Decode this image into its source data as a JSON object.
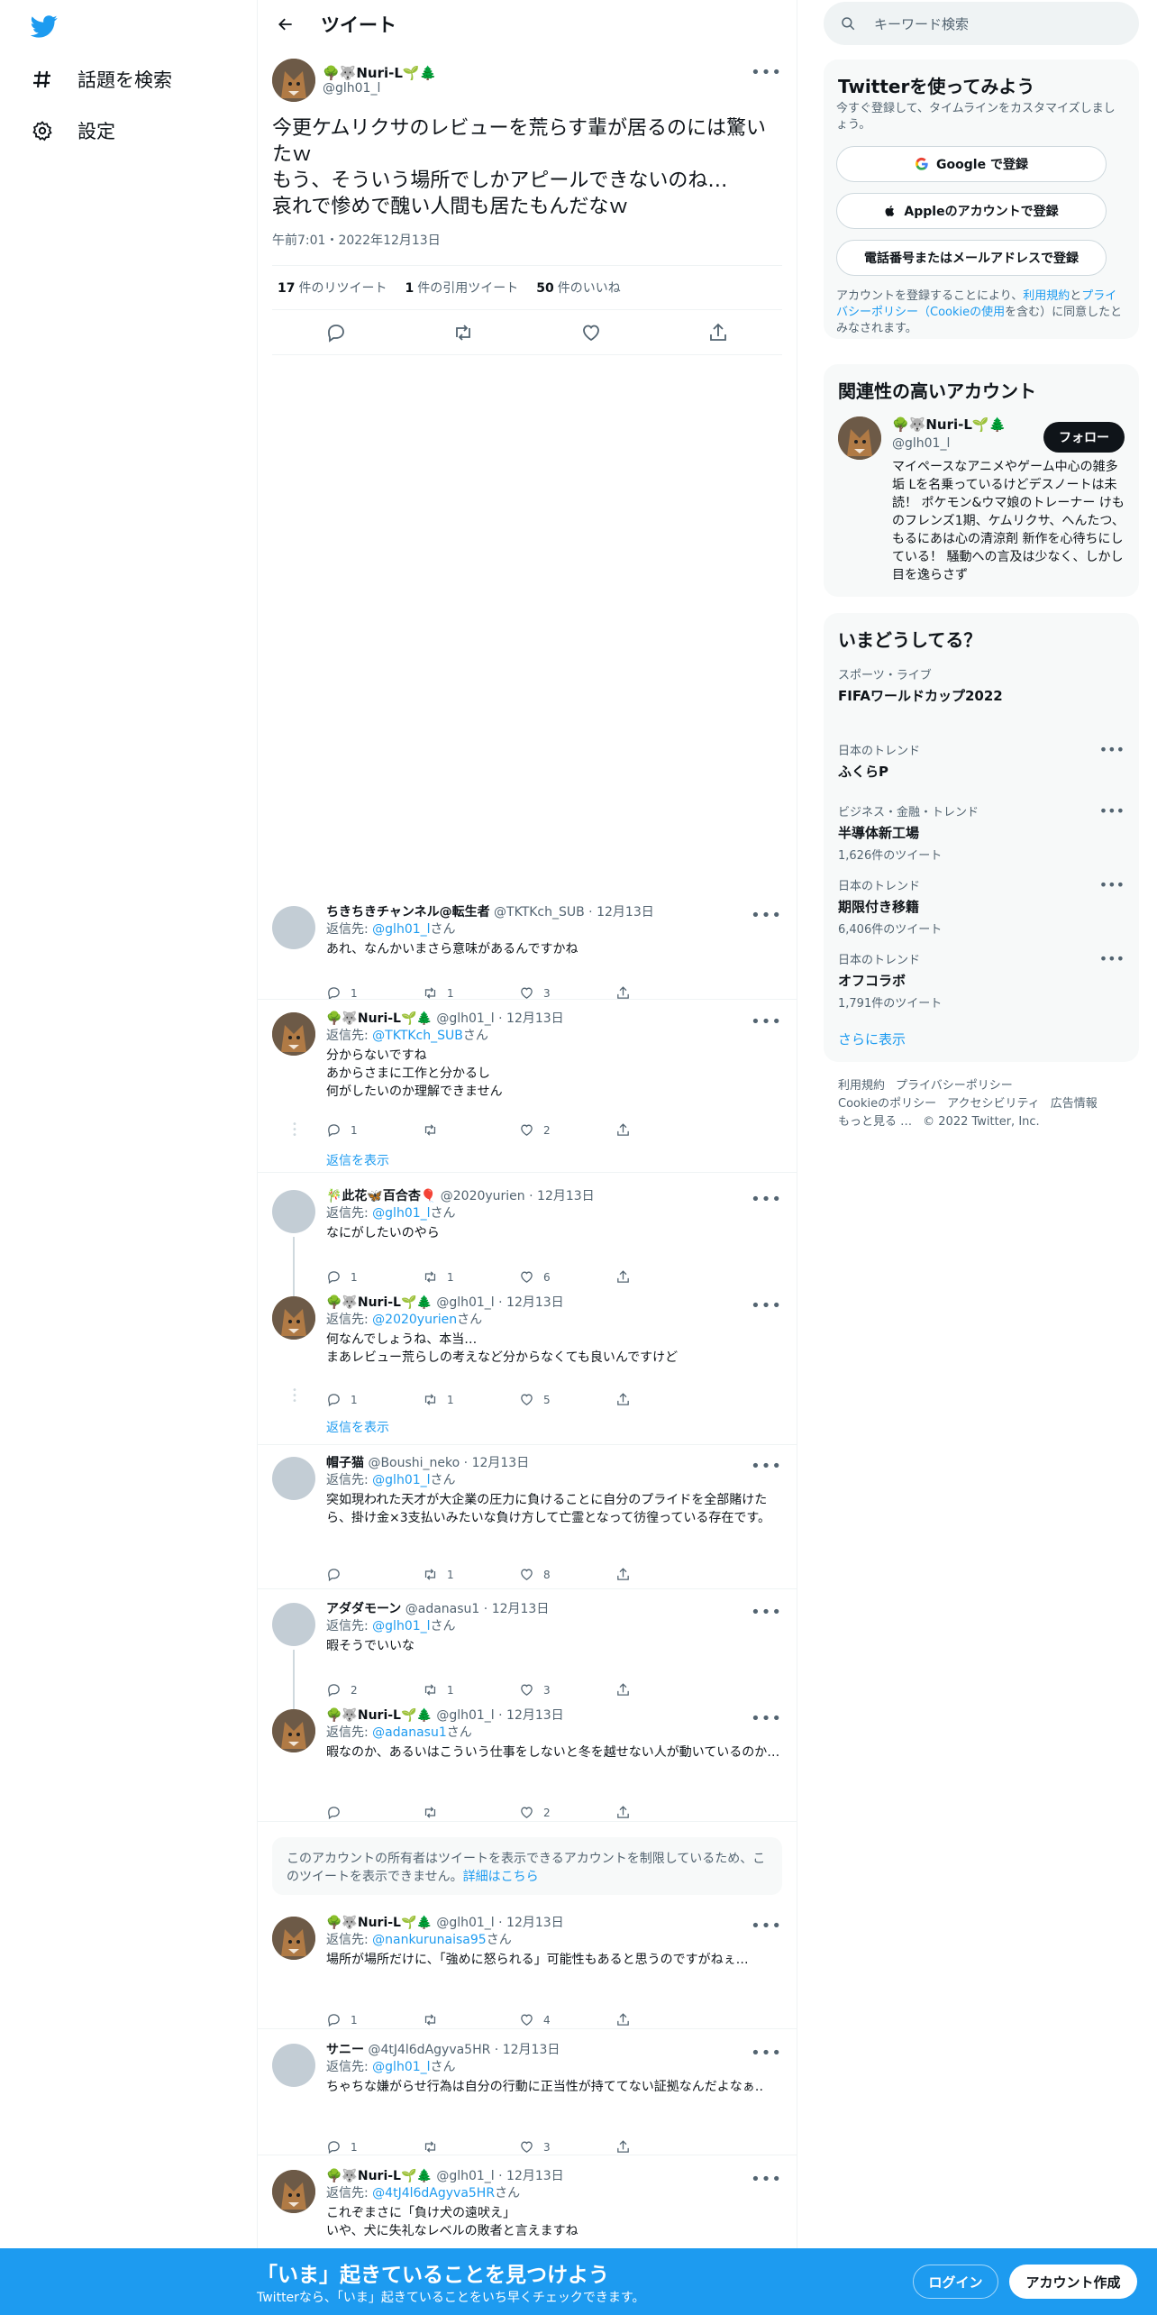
{
  "nav": {
    "explore_label": "話題を検索",
    "settings_label": "設定"
  },
  "header": {
    "title": "ツイート"
  },
  "main_tweet": {
    "name": "🌳🐺Nuri-L🌱🌲",
    "handle": "@glh01_l",
    "text": "今更ケムリクサのレビューを荒らす輩が居るのには驚いたｗ\nもう、そういう場所でしかアピールできないのね…\n哀れで惨めで醜い人間も居たもんだなｗ",
    "time": "午前7:01・2022年12月13日",
    "retweets_count": "17",
    "retweets_label": "件のリツイート",
    "quotes_count": "1",
    "quotes_label": "件の引用ツイート",
    "likes_count": "50",
    "likes_label": "件のいいね"
  },
  "replies": [
    {
      "name": "ちきちきチャンネル@転生者",
      "handle": "@TKTKch_SUB",
      "date": "12月13日",
      "to_prefix": "返信先: ",
      "to": "@glh01_l",
      "to_suffix": "さん",
      "text": "あれ、なんかいまさら意味があるんですかね",
      "reply": "1",
      "rt": "1",
      "like": "3"
    },
    {
      "name": "🌳🐺Nuri-L🌱🌲",
      "handle": "@glh01_l",
      "date": "12月13日",
      "to_prefix": "返信先: ",
      "to": "@TKTKch_SUB",
      "to_suffix": "さん",
      "text": "分からないですね\nあからさまに工作と分かるし\n何がしたいのか理解できません",
      "reply": "1",
      "rt": "",
      "like": "2"
    },
    {
      "name": "🎋此花🦋百合杏🎈",
      "handle": "@2020yurien",
      "date": "12月13日",
      "to_prefix": "返信先: ",
      "to": "@glh01_l",
      "to_suffix": "さん",
      "text": "なにがしたいのやら",
      "reply": "1",
      "rt": "1",
      "like": "6"
    },
    {
      "name": "🌳🐺Nuri-L🌱🌲",
      "handle": "@glh01_l",
      "date": "12月13日",
      "to_prefix": "返信先: ",
      "to": "@2020yurien",
      "to_suffix": "さん",
      "text": "何なんでしょうね、本当…\nまあレビュー荒らしの考えなど分からなくても良いんですけど",
      "reply": "1",
      "rt": "1",
      "like": "5"
    },
    {
      "name": "帽子猫",
      "handle": "@Boushi_neko",
      "date": "12月13日",
      "to_prefix": "返信先: ",
      "to": "@glh01_l",
      "to_suffix": "さん",
      "text": "突如現われた天才が大企業の圧力に負けることに自分のプライドを全部賭けたら、掛け金×3支払いみたいな負け方して亡霊となって彷徨っている存在です。",
      "reply": "",
      "rt": "1",
      "like": "8"
    },
    {
      "name": "アダダモーン",
      "handle": "@adanasu1",
      "date": "12月13日",
      "to_prefix": "返信先: ",
      "to": "@glh01_l",
      "to_suffix": "さん",
      "text": "暇そうでいいな",
      "reply": "2",
      "rt": "1",
      "like": "3"
    },
    {
      "name": "🌳🐺Nuri-L🌱🌲",
      "handle": "@glh01_l",
      "date": "12月13日",
      "to_prefix": "返信先: ",
      "to": "@adanasu1",
      "to_suffix": "さん",
      "text": "暇なのか、あるいはこういう仕事をしないと冬を越せない人が動いているのか…",
      "reply": "",
      "rt": "",
      "like": "2"
    },
    {
      "name": "🌳🐺Nuri-L🌱🌲",
      "handle": "@glh01_l",
      "date": "12月13日",
      "to_prefix": "返信先: ",
      "to": "@nankurunaisa95",
      "to_suffix": "さん",
      "text": "場所が場所だけに、「強めに怒られる」可能性もあると思うのですがねぇ…",
      "reply": "1",
      "rt": "",
      "like": "4"
    },
    {
      "name": "サニー",
      "handle": "@4tJ4l6dAgyva5HR",
      "date": "12月13日",
      "to_prefix": "返信先: ",
      "to": "@glh01_l",
      "to_suffix": "さん",
      "text": "ちゃちな嫌がらせ行為は自分の行動に正当性が持ててない証拠なんだよなぁ‥",
      "reply": "1",
      "rt": "",
      "like": "3"
    },
    {
      "name": "🌳🐺Nuri-L🌱🌲",
      "handle": "@glh01_l",
      "date": "12月13日",
      "to_prefix": "返信先: ",
      "to": "@4tJ4l6dAgyva5HR",
      "to_suffix": "さん",
      "text": "これぞまさに「負け犬の遠吠え」\nいや、犬に失礼なレベルの敗者と言えますね",
      "reply": "",
      "rt": "",
      "like": ""
    }
  ],
  "show_replies_label": "返信を表示",
  "notice": {
    "text": "このアカウントの所有者はツイートを表示できるアカウントを制限しているため、このツイートを表示できません。",
    "link": "詳細はこちら"
  },
  "sidebar": {
    "search_placeholder": "キーワード検索",
    "signup": {
      "title": "Twitterを使ってみよう",
      "desc": "今すぐ登録して、タイムラインをカスタマイズしましょう。",
      "google": "Google で登録",
      "apple": "Appleのアカウントで登録",
      "phone": "電話番号またはメールアドレスで登録",
      "terms_1": "アカウントを登録することにより、",
      "terms_link1": "利用規約",
      "terms_2": "と",
      "terms_link2": "プライバシーポリシー（Cookieの使用",
      "terms_3": "を含む）に同意したとみなされます。"
    },
    "relevant": {
      "title": "関連性の高いアカウント",
      "name": "🌳🐺Nuri-L🌱🌲",
      "handle": "@glh01_l",
      "follow": "フォロー",
      "bio": "マイペースなアニメやゲーム中心の雑多垢 Lを名乗っているけどデスノートは未読！ ポケモン&ウマ娘のトレーナー けものフレンズ1期、ケムリクサ、へんたつ、もるにあは心の清涼剤 新作を心待ちにしている！ 騒動への言及は少なく、しかし目を逸らさず"
    },
    "trends": {
      "title": "いまどうしてる？",
      "items": [
        {
          "cat": "スポーツ・ライブ",
          "title": "FIFAワールドカップ2022",
          "count": ""
        },
        {
          "cat": "日本のトレンド",
          "title": "ふくらP",
          "count": ""
        },
        {
          "cat": "ビジネス・金融・トレンド",
          "title": "半導体新工場",
          "count": "1,626件のツイート"
        },
        {
          "cat": "日本のトレンド",
          "title": "期限付き移籍",
          "count": "6,406件のツイート"
        },
        {
          "cat": "日本のトレンド",
          "title": "オフコラボ",
          "count": "1,791件のツイート"
        }
      ],
      "show_more": "さらに表示"
    },
    "footer": {
      "links": [
        "利用規約",
        "プライバシーポリシー",
        "Cookieのポリシー",
        "アクセシビリティ",
        "広告情報",
        "もっと見る …"
      ],
      "copyright": "© 2022 Twitter, Inc."
    }
  },
  "bottombar": {
    "title": "「いま」起きていることを見つけよう",
    "subtitle": "Twitterなら、「いま」起きていることをいち早くチェックできます。",
    "login": "ログイン",
    "signup": "アカウント作成"
  },
  "colors": {
    "accent": "#1d9bf0",
    "text": "#0f1419",
    "muted": "#536471",
    "border": "#eff3f4"
  }
}
